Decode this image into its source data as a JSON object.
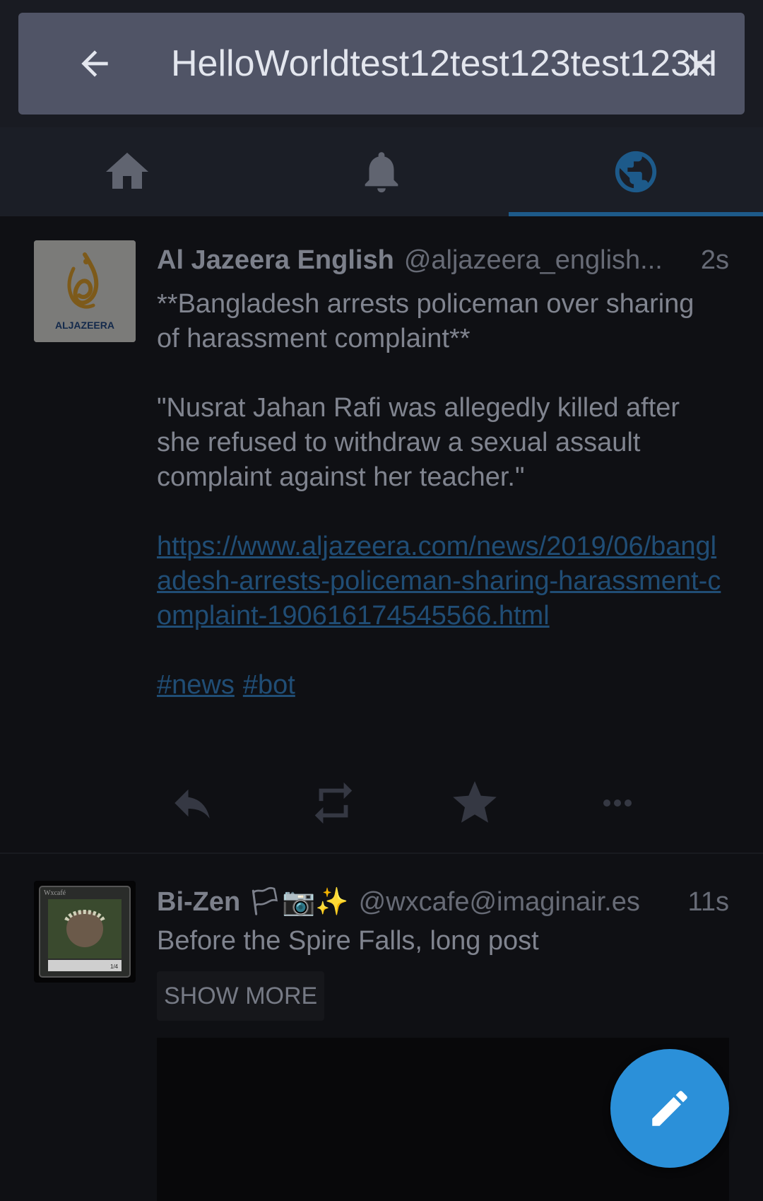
{
  "search": {
    "query": "HelloWorldtest12test123test123H"
  },
  "tabs": [
    {
      "name": "home"
    },
    {
      "name": "notifications"
    },
    {
      "name": "public"
    }
  ],
  "statuses": [
    {
      "display_name": "Al Jazeera English",
      "account": "@aljazeera_english...",
      "timestamp": "2s",
      "avatar_text": "ALJAZEERA",
      "paragraph1": "**Bangladesh arrests policeman over sharing of harassment complaint**",
      "paragraph2": "\"Nusrat Jahan Rafi was allegedly killed after she refused to withdraw a sexual assault complaint against her teacher.\"",
      "link": "https://www.aljazeera.com/news/2019/06/bangladesh-arrests-policeman-sharing-harassment-complaint-190616174545566.html",
      "hashtags": [
        "#news",
        "#bot"
      ]
    },
    {
      "display_name": "Bi-Zen 🏳📷✨",
      "account": "@wxcafe@imaginair.es",
      "timestamp": "11s",
      "spoiler_text": "Before the Spire Falls, long post",
      "show_more_label": "SHOW MORE",
      "avatar_card_title": "Wxcafé",
      "avatar_card_counter": "1/4"
    }
  ],
  "colors": {
    "accent": "#2b90d9",
    "link": "#204d75",
    "search_bar": "#505466"
  }
}
